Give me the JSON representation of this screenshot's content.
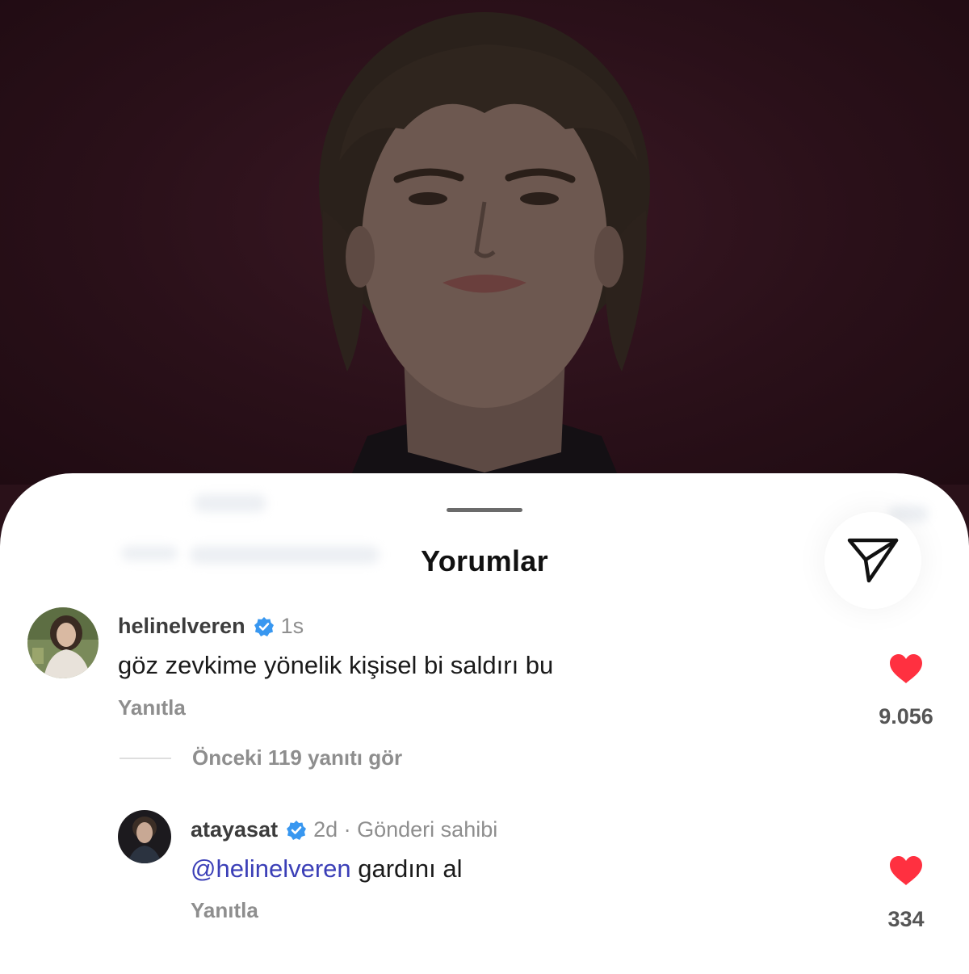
{
  "sheet": {
    "title": "Yorumlar"
  },
  "icons": {
    "share": "paper-plane-icon",
    "verified": "verified-badge-icon",
    "like": "heart-icon"
  },
  "colors": {
    "like_red": "#ff3040",
    "verified_blue": "#3897f0",
    "mention": "#3b3fb7",
    "muted": "#8e8e8e"
  },
  "comments": [
    {
      "username": "helinelveren",
      "verified": true,
      "meta": "1s",
      "text": "göz zevkime yönelik kişisel bi saldırı bu",
      "reply_label": "Yanıtla",
      "likes": "9.056",
      "liked": true
    }
  ],
  "replies_toggle": "Önceki 119 yanıtı gör",
  "replies": [
    {
      "username": "atayasat",
      "verified": true,
      "meta": "2d · Gönderi sahibi",
      "mention": "@helinelveren",
      "text": " gardını al",
      "reply_label": "Yanıtla",
      "likes": "334",
      "liked": true
    }
  ]
}
